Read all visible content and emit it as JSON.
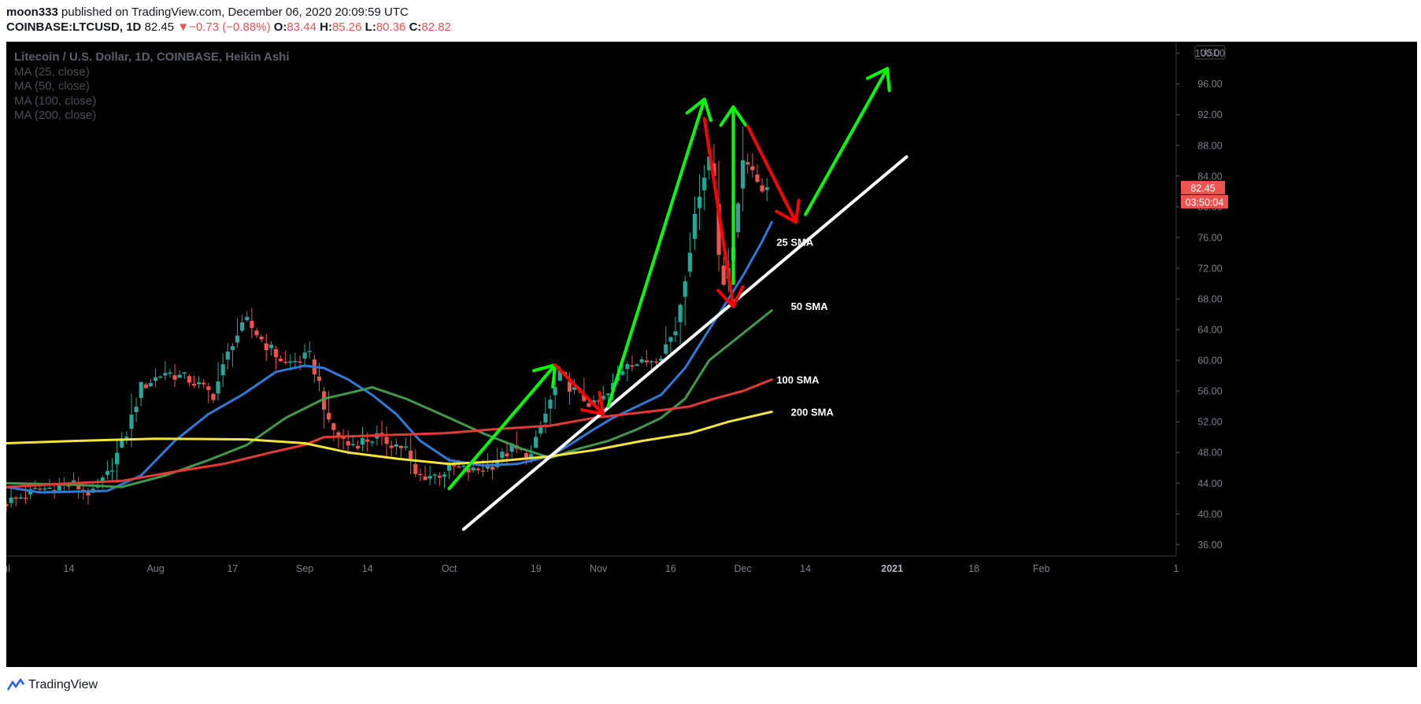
{
  "header": {
    "author": "moon333",
    "published_text": "published on TradingView.com, December 06, 2020 20:09:59 UTC",
    "symbol": "COINBASE:LTCUSD, 1D",
    "last": "82.45",
    "change_arrow": "▼",
    "change": "−0.73 (−0.88%)",
    "o_label": "O:",
    "o_value": "83.44",
    "h_label": "H:",
    "h_value": "85.26",
    "l_label": "L:",
    "l_value": "80.36",
    "c_label": "C:",
    "c_value": "82.82"
  },
  "legend": {
    "title": "Litecoin / U.S. Dollar, 1D, COINBASE, Heikin Ashi",
    "indicators": [
      "MA (25, close)",
      "MA (50, close)",
      "MA (100, close)",
      "MA (200, close)"
    ]
  },
  "footer": {
    "brand": "TradingView",
    "logo_icon": "tradingview-logo-icon"
  },
  "colors": {
    "background": "#000000",
    "up": "#26a69a",
    "down": "#ef5350",
    "ma25": "#2e7ad6",
    "ma50": "#3f9a4b",
    "ma100": "#e53935",
    "ma200": "#f2e43a",
    "arrow_up": "#00ff00",
    "arrow_down": "#ff0000",
    "trendline": "#ffffff",
    "axis_text": "#7c808b",
    "price_badge": "#ef5350"
  },
  "chart_data": {
    "type": "candlestick",
    "title": "Litecoin / U.S. Dollar, 1D, COINBASE, Heikin Ashi",
    "currency": "USD",
    "ylim": [
      34.5,
      101.5
    ],
    "y_ticks": [
      "36.00",
      "40.00",
      "44.00",
      "48.00",
      "52.00",
      "56.00",
      "60.00",
      "64.00",
      "68.00",
      "72.00",
      "76.00",
      "80.00",
      "84.00",
      "88.00",
      "92.00",
      "96.00",
      "100.00"
    ],
    "x_range": [
      "2020-07-01",
      "2021-03-01"
    ],
    "x_ticks": [
      {
        "label": "ul",
        "date": "2020-07-01",
        "bold": false
      },
      {
        "label": "14",
        "date": "2020-07-14",
        "bold": false
      },
      {
        "label": "Aug",
        "date": "2020-08-01",
        "bold": false
      },
      {
        "label": "17",
        "date": "2020-08-17",
        "bold": false
      },
      {
        "label": "Sep",
        "date": "2020-09-01",
        "bold": false
      },
      {
        "label": "14",
        "date": "2020-09-14",
        "bold": false
      },
      {
        "label": "Oct",
        "date": "2020-10-01",
        "bold": false
      },
      {
        "label": "19",
        "date": "2020-10-19",
        "bold": false
      },
      {
        "label": "Nov",
        "date": "2020-11-01",
        "bold": false
      },
      {
        "label": "16",
        "date": "2020-11-16",
        "bold": false
      },
      {
        "label": "Dec",
        "date": "2020-12-01",
        "bold": false
      },
      {
        "label": "14",
        "date": "2020-12-14",
        "bold": false
      },
      {
        "label": "2021",
        "date": "2021-01-01",
        "bold": true
      },
      {
        "label": "18",
        "date": "2021-01-18",
        "bold": false
      },
      {
        "label": "Feb",
        "date": "2021-02-01",
        "bold": false
      },
      {
        "label": "1",
        "date": "2021-03-01",
        "bold": false
      }
    ],
    "price_badge": {
      "value": 82.45,
      "label": "82.45",
      "countdown": "03:50:04"
    },
    "candle_path": [
      [
        "2020-07-01",
        41.5
      ],
      [
        "2020-07-08",
        43.2
      ],
      [
        "2020-07-15",
        43.8
      ],
      [
        "2020-07-19",
        42.5
      ],
      [
        "2020-07-22",
        45.0
      ],
      [
        "2020-07-26",
        50.5
      ],
      [
        "2020-07-29",
        56.5
      ],
      [
        "2020-08-03",
        58.5
      ],
      [
        "2020-08-08",
        57.5
      ],
      [
        "2020-08-13",
        55.5
      ],
      [
        "2020-08-17",
        62.5
      ],
      [
        "2020-08-20",
        65.0
      ],
      [
        "2020-08-24",
        62.0
      ],
      [
        "2020-08-28",
        59.5
      ],
      [
        "2020-09-02",
        60.5
      ],
      [
        "2020-09-04",
        57.0
      ],
      [
        "2020-09-06",
        51.5
      ],
      [
        "2020-09-10",
        49.0
      ],
      [
        "2020-09-16",
        50.0
      ],
      [
        "2020-09-22",
        48.5
      ],
      [
        "2020-09-24",
        45.0
      ],
      [
        "2020-09-28",
        45.0
      ],
      [
        "2020-10-02",
        46.0
      ],
      [
        "2020-10-06",
        45.5
      ],
      [
        "2020-10-10",
        46.5
      ],
      [
        "2020-10-14",
        48.5
      ],
      [
        "2020-10-18",
        47.5
      ],
      [
        "2020-10-21",
        53.0
      ],
      [
        "2020-10-24",
        58.0
      ],
      [
        "2020-10-27",
        56.0
      ],
      [
        "2020-10-31",
        54.0
      ],
      [
        "2020-11-03",
        55.5
      ],
      [
        "2020-11-07",
        60.0
      ],
      [
        "2020-11-10",
        59.5
      ],
      [
        "2020-11-14",
        61.0
      ],
      [
        "2020-11-17",
        64.0
      ],
      [
        "2020-11-19",
        71.0
      ],
      [
        "2020-11-22",
        82.0
      ],
      [
        "2020-11-24",
        86.5
      ],
      [
        "2020-11-25",
        84.0
      ],
      [
        "2020-11-26",
        74.0
      ],
      [
        "2020-11-27",
        70.5
      ],
      [
        "2020-11-29",
        74.0
      ],
      [
        "2020-11-30",
        80.5
      ],
      [
        "2020-12-01",
        86.5
      ],
      [
        "2020-12-02",
        86.0
      ],
      [
        "2020-12-03",
        84.0
      ],
      [
        "2020-12-04",
        83.5
      ],
      [
        "2020-12-05",
        82.5
      ],
      [
        "2020-12-06",
        82.5
      ]
    ],
    "series": [
      {
        "name": "25 SMA",
        "color": "#2e7ad6",
        "points": [
          [
            "2020-07-01",
            43.5
          ],
          [
            "2020-07-08",
            42.8
          ],
          [
            "2020-07-22",
            43.0
          ],
          [
            "2020-07-29",
            45.0
          ],
          [
            "2020-08-05",
            49.5
          ],
          [
            "2020-08-12",
            53.0
          ],
          [
            "2020-08-19",
            55.5
          ],
          [
            "2020-08-26",
            58.5
          ],
          [
            "2020-09-01",
            59.3
          ],
          [
            "2020-09-05",
            59.0
          ],
          [
            "2020-09-10",
            57.5
          ],
          [
            "2020-09-15",
            55.5
          ],
          [
            "2020-09-20",
            53.0
          ],
          [
            "2020-09-25",
            49.5
          ],
          [
            "2020-10-01",
            47.0
          ],
          [
            "2020-10-08",
            46.3
          ],
          [
            "2020-10-15",
            46.5
          ],
          [
            "2020-10-22",
            47.5
          ],
          [
            "2020-10-26",
            49.0
          ],
          [
            "2020-10-31",
            51.0
          ],
          [
            "2020-11-04",
            52.5
          ],
          [
            "2020-11-09",
            54.0
          ],
          [
            "2020-11-14",
            55.5
          ],
          [
            "2020-11-19",
            59.0
          ],
          [
            "2020-11-24",
            64.0
          ],
          [
            "2020-11-28",
            68.0
          ],
          [
            "2020-12-01",
            71.0
          ],
          [
            "2020-12-05",
            75.5
          ],
          [
            "2020-12-07",
            78.0
          ]
        ]
      },
      {
        "name": "50 SMA",
        "color": "#3f9a4b",
        "points": [
          [
            "2020-07-01",
            44.0
          ],
          [
            "2020-07-15",
            43.8
          ],
          [
            "2020-07-25",
            43.5
          ],
          [
            "2020-08-03",
            45.0
          ],
          [
            "2020-08-12",
            47.0
          ],
          [
            "2020-08-20",
            49.0
          ],
          [
            "2020-08-28",
            52.5
          ],
          [
            "2020-09-05",
            55.0
          ],
          [
            "2020-09-12",
            56.0
          ],
          [
            "2020-09-15",
            56.5
          ],
          [
            "2020-09-22",
            55.0
          ],
          [
            "2020-10-01",
            52.5
          ],
          [
            "2020-10-08",
            50.5
          ],
          [
            "2020-10-16",
            48.5
          ],
          [
            "2020-10-22",
            47.3
          ],
          [
            "2020-10-28",
            48.5
          ],
          [
            "2020-11-03",
            49.5
          ],
          [
            "2020-11-09",
            51.0
          ],
          [
            "2020-11-14",
            52.5
          ],
          [
            "2020-11-19",
            55.0
          ],
          [
            "2020-11-24",
            60.0
          ],
          [
            "2020-11-29",
            62.5
          ],
          [
            "2020-12-03",
            64.5
          ],
          [
            "2020-12-07",
            66.5
          ]
        ]
      },
      {
        "name": "100 SMA",
        "color": "#e53935",
        "points": [
          [
            "2020-07-01",
            43.5
          ],
          [
            "2020-07-15",
            44.0
          ],
          [
            "2020-07-25",
            44.3
          ],
          [
            "2020-08-05",
            45.5
          ],
          [
            "2020-08-15",
            46.5
          ],
          [
            "2020-08-25",
            48.0
          ],
          [
            "2020-09-01",
            49.0
          ],
          [
            "2020-09-05",
            50.0
          ],
          [
            "2020-09-15",
            50.2
          ],
          [
            "2020-09-30",
            50.5
          ],
          [
            "2020-10-10",
            51.0
          ],
          [
            "2020-10-22",
            51.5
          ],
          [
            "2020-10-31",
            52.5
          ],
          [
            "2020-11-07",
            53.0
          ],
          [
            "2020-11-14",
            53.5
          ],
          [
            "2020-11-20",
            54.0
          ],
          [
            "2020-11-25",
            55.0
          ],
          [
            "2020-12-01",
            56.0
          ],
          [
            "2020-12-07",
            57.5
          ]
        ]
      },
      {
        "name": "200 SMA",
        "color": "#f2e43a",
        "points": [
          [
            "2020-07-01",
            49.2
          ],
          [
            "2020-07-15",
            49.5
          ],
          [
            "2020-08-01",
            49.8
          ],
          [
            "2020-08-20",
            49.7
          ],
          [
            "2020-09-01",
            49.2
          ],
          [
            "2020-09-10",
            48.0
          ],
          [
            "2020-09-20",
            47.2
          ],
          [
            "2020-10-01",
            46.5
          ],
          [
            "2020-10-10",
            46.8
          ],
          [
            "2020-10-22",
            47.5
          ],
          [
            "2020-10-31",
            48.3
          ],
          [
            "2020-11-10",
            49.5
          ],
          [
            "2020-11-20",
            50.5
          ],
          [
            "2020-11-28",
            52.0
          ],
          [
            "2020-12-07",
            53.3
          ]
        ]
      }
    ],
    "series_labels": [
      {
        "text": "25 SMA",
        "date": "2020-12-07",
        "price": 75.3
      },
      {
        "text": "50 SMA",
        "date": "2020-12-10",
        "price": 67.0
      },
      {
        "text": "100 SMA",
        "date": "2020-12-07",
        "price": 57.4
      },
      {
        "text": "200 SMA",
        "date": "2020-12-10",
        "price": 53.2
      }
    ],
    "annotations": [
      {
        "kind": "trendline",
        "color": "#ffffff",
        "points": [
          [
            "2020-10-04",
            38.0
          ],
          [
            "2021-01-04",
            86.5
          ]
        ]
      },
      {
        "kind": "arrow",
        "color": "#00ff00",
        "points": [
          [
            "2020-10-01",
            43.3
          ],
          [
            "2020-10-23",
            59.4
          ]
        ]
      },
      {
        "kind": "arrow",
        "color": "#ff0000",
        "points": [
          [
            "2020-10-23",
            59.4
          ],
          [
            "2020-11-02",
            53.0
          ]
        ]
      },
      {
        "kind": "arrow",
        "color": "#00ff00",
        "points": [
          [
            "2020-11-03",
            54.0
          ],
          [
            "2020-11-23",
            94.0
          ]
        ]
      },
      {
        "kind": "arrow",
        "color": "#ff0000",
        "points": [
          [
            "2020-11-23",
            91.5
          ],
          [
            "2020-11-29",
            67.0
          ]
        ]
      },
      {
        "kind": "arrow",
        "color": "#00ff00",
        "points": [
          [
            "2020-11-29",
            70.0
          ],
          [
            "2020-11-29",
            93.0
          ]
        ]
      },
      {
        "kind": "arrow",
        "color": "#ff0000",
        "points": [
          [
            "2020-12-02",
            90.5
          ],
          [
            "2020-12-12",
            78.0
          ]
        ]
      },
      {
        "kind": "arrow",
        "color": "#00ff00",
        "points": [
          [
            "2020-12-14",
            79.0
          ],
          [
            "2020-12-31",
            98.0
          ]
        ]
      }
    ]
  }
}
